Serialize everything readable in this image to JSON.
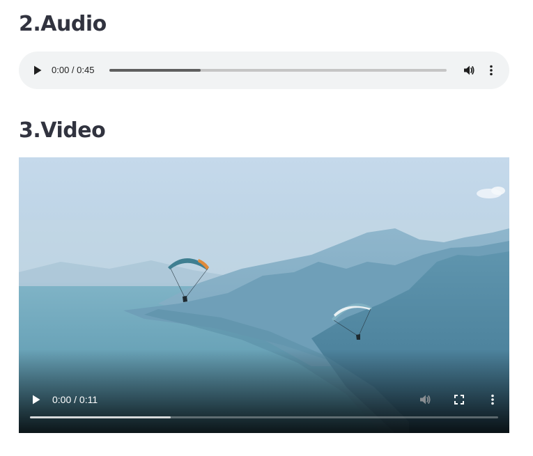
{
  "sections": {
    "audio": {
      "heading": "2.Audio"
    },
    "video": {
      "heading": "3.Video"
    }
  },
  "audio_player": {
    "current_time": "0:00",
    "duration": "0:45",
    "time_display": "0:00 / 0:45",
    "buffered_fraction": 0.27,
    "icons": [
      "play-icon",
      "volume-icon",
      "more-options-icon"
    ]
  },
  "video_player": {
    "current_time": "0:00",
    "duration": "0:11",
    "time_display": "0:00 / 0:11",
    "buffered_fraction": 0.3,
    "muted_volume_disabled": true,
    "icons": [
      "play-icon",
      "volume-icon",
      "fullscreen-icon",
      "more-options-icon"
    ],
    "scene": "paragliders over lake and mountains"
  },
  "colors": {
    "heading": "#31333f",
    "audio_bg": "#f1f3f4",
    "sky_top": "#c9dced",
    "water": "#5e9db4"
  }
}
